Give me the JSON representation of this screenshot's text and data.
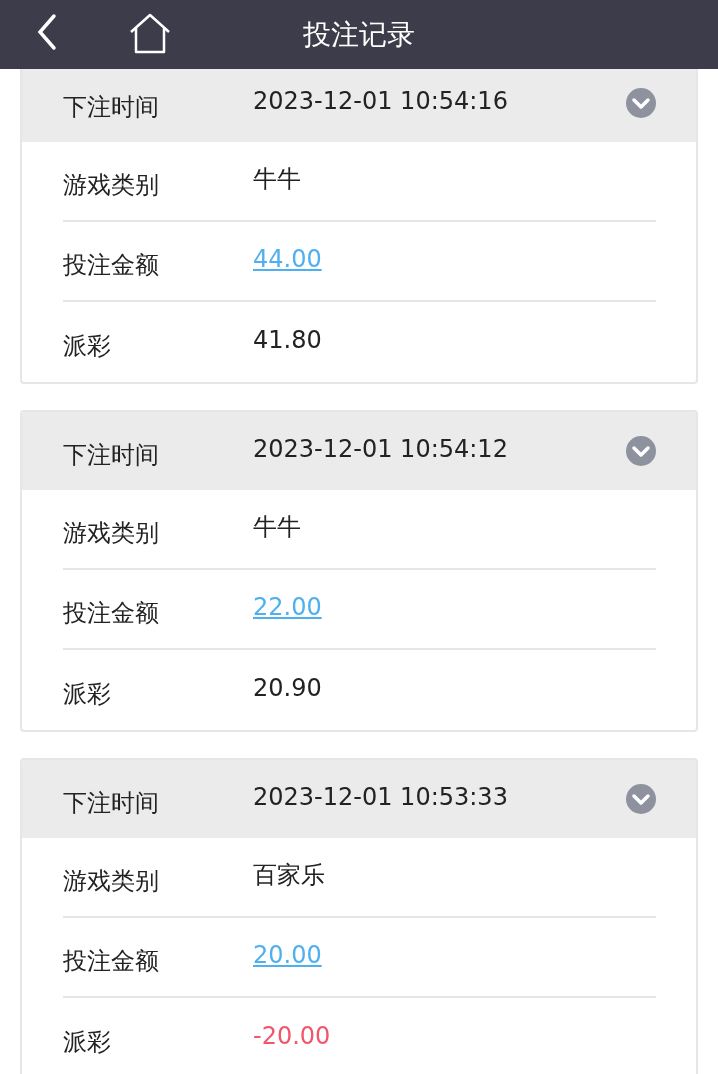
{
  "header": {
    "title": "投注记录"
  },
  "records": [
    {
      "time_label": "下注时间",
      "time": "2023-12-01 10:54:16",
      "expanded": false,
      "rows": [
        {
          "label": "游戏类别",
          "value": "牛牛",
          "kind": "plain"
        },
        {
          "label": "投注金额",
          "value": "44.00",
          "kind": "link"
        },
        {
          "label": "派彩",
          "value": "41.80",
          "kind": "plain"
        }
      ]
    },
    {
      "time_label": "下注时间",
      "time": "2023-12-01 10:54:12",
      "expanded": false,
      "rows": [
        {
          "label": "游戏类别",
          "value": "牛牛",
          "kind": "plain"
        },
        {
          "label": "投注金额",
          "value": "22.00",
          "kind": "link"
        },
        {
          "label": "派彩",
          "value": "20.90",
          "kind": "plain"
        }
      ]
    },
    {
      "time_label": "下注时间",
      "time": "2023-12-01 10:53:33",
      "expanded": false,
      "rows": [
        {
          "label": "游戏类别",
          "value": "百家乐",
          "kind": "plain"
        },
        {
          "label": "投注金额",
          "value": "20.00",
          "kind": "link"
        },
        {
          "label": "派彩",
          "value": "-20.00",
          "kind": "negative"
        }
      ]
    }
  ]
}
